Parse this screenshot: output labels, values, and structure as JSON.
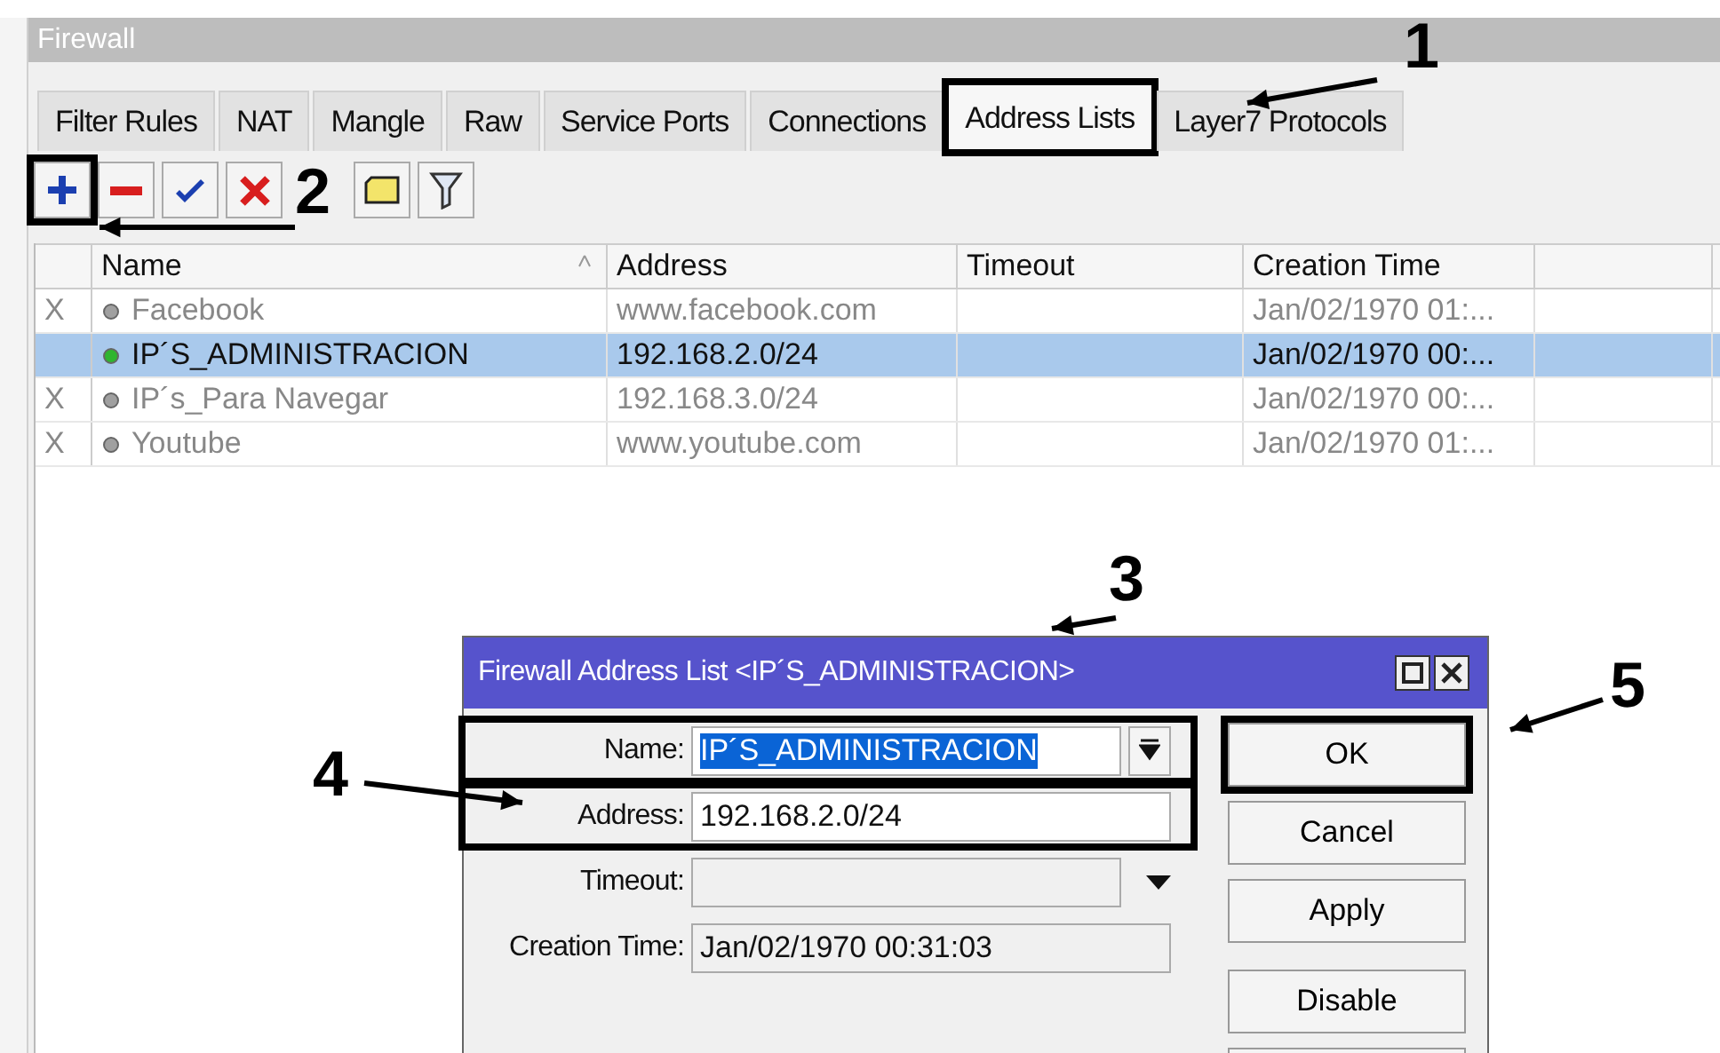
{
  "window": {
    "title": "Firewall"
  },
  "tabs": [
    {
      "label": "Filter Rules",
      "selected": false,
      "framed": false
    },
    {
      "label": "NAT",
      "selected": false,
      "framed": false
    },
    {
      "label": "Mangle",
      "selected": false,
      "framed": false
    },
    {
      "label": "Raw",
      "selected": false,
      "framed": false
    },
    {
      "label": "Service Ports",
      "selected": false,
      "framed": false
    },
    {
      "label": "Connections",
      "selected": false,
      "framed": false
    },
    {
      "label": "Address Lists",
      "selected": true,
      "framed": true
    },
    {
      "label": "Layer7 Protocols",
      "selected": false,
      "framed": false
    }
  ],
  "toolbar": [
    {
      "kind": "add",
      "framed": true
    },
    {
      "kind": "remove",
      "framed": false
    },
    {
      "kind": "enable",
      "framed": false
    },
    {
      "kind": "disable",
      "framed": false
    },
    {
      "kind": "comment",
      "framed": false
    },
    {
      "kind": "filter",
      "framed": false
    }
  ],
  "table": {
    "columns": [
      {
        "label": "Name",
        "sorted": true
      },
      {
        "label": "Address",
        "sorted": false
      },
      {
        "label": "Timeout",
        "sorted": false
      },
      {
        "label": "Creation Time",
        "sorted": false
      }
    ],
    "rows": [
      {
        "flag": "X",
        "disabled": true,
        "selected": false,
        "name": "Facebook",
        "address": "www.facebook.com",
        "creation_time": "Jan/02/1970 01:..."
      },
      {
        "disabled": false,
        "selected": true,
        "name": "IP´S_ADMINISTRACION",
        "address": "192.168.2.0/24",
        "creation_time": "Jan/02/1970 00:..."
      },
      {
        "flag": "X",
        "disabled": true,
        "selected": false,
        "name": "IP´s_Para Navegar",
        "address": "192.168.3.0/24",
        "creation_time": "Jan/02/1970 00:..."
      },
      {
        "flag": "X",
        "disabled": true,
        "selected": false,
        "name": "Youtube",
        "address": "www.youtube.com",
        "creation_time": "Jan/02/1970 01:..."
      }
    ]
  },
  "dialog": {
    "title": "Firewall Address List <IP´S_ADMINISTRACION>",
    "fields": [
      {
        "label": "Name:",
        "value": "IP´S_ADMINISTRACION",
        "kind": "combo",
        "text_selected": true,
        "framed": true
      },
      {
        "label": "Address:",
        "value": "192.168.2.0/24",
        "kind": "text",
        "framed": true
      },
      {
        "label": "Timeout:",
        "kind": "dropdown",
        "framed": false
      },
      {
        "label": "Creation Time:",
        "value": "Jan/02/1970 00:31:03",
        "kind": "readonly",
        "framed": false
      }
    ],
    "buttons": [
      {
        "label": "OK",
        "framed": true
      },
      {
        "label": "Cancel",
        "framed": false
      },
      {
        "label": "Apply",
        "framed": false
      },
      {
        "label": "Disable",
        "framed": false
      }
    ]
  },
  "annotations": [
    "1",
    "2",
    "3",
    "4",
    "5"
  ]
}
